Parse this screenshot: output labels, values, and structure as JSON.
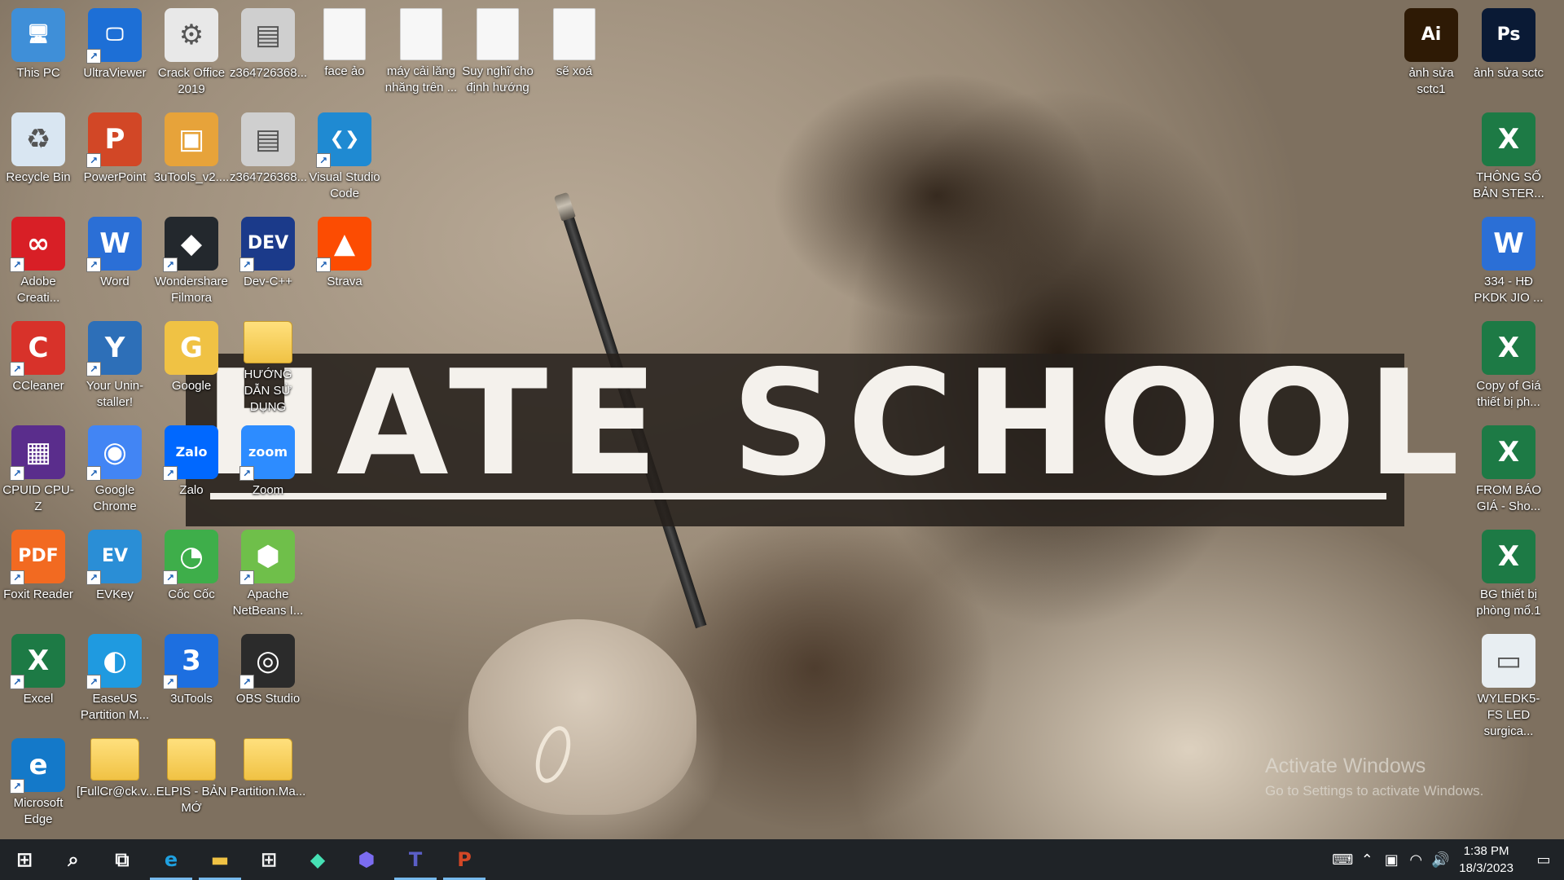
{
  "desktop": {
    "icons": [
      {
        "label": "This PC",
        "icon": "this-pc-icon",
        "color": "#3f8fd8",
        "glyph": "🖥"
      },
      {
        "label": "UltraViewer",
        "icon": "ultraviewer-icon",
        "color": "#1d6fd6",
        "glyph": "🖵"
      },
      {
        "label": "Crack Office 2019",
        "icon": "gear-file-icon",
        "color": "#e8e8e8",
        "glyph": "⚙"
      },
      {
        "label": "z364726368...",
        "icon": "image-file-icon",
        "color": "#cfcfcf",
        "glyph": "▤"
      },
      {
        "label": "face ảo",
        "icon": "blank-file-icon",
        "color": "#f7f7f7",
        "glyph": ""
      },
      {
        "label": "máy cải lăng nhăng trên ...",
        "icon": "blank-file-icon",
        "color": "#f7f7f7",
        "glyph": ""
      },
      {
        "label": "Suy nghĩ cho định hướng",
        "icon": "blank-file-icon",
        "color": "#f7f7f7",
        "glyph": ""
      },
      {
        "label": "sẽ xoá",
        "icon": "blank-file-icon",
        "color": "#f7f7f7",
        "glyph": ""
      },
      {
        "label": "Recycle Bin",
        "icon": "recycle-bin-icon",
        "color": "#d9e6f2",
        "glyph": "♻"
      },
      {
        "label": "PowerPoint",
        "icon": "powerpoint-icon",
        "color": "#d24726",
        "glyph": "P"
      },
      {
        "label": "3uTools_v2....",
        "icon": "3utools-installer-icon",
        "color": "#e7a33a",
        "glyph": "▣"
      },
      {
        "label": "z364726368...",
        "icon": "image-file-icon",
        "color": "#cfcfcf",
        "glyph": "▤"
      },
      {
        "label": "Visual Studio Code",
        "icon": "vscode-icon",
        "color": "#1f8ad2",
        "glyph": "❮❯"
      },
      {
        "label": "Adobe Creati...",
        "icon": "adobe-cc-icon",
        "color": "#d81f26",
        "glyph": "∞"
      },
      {
        "label": "Word",
        "icon": "word-icon",
        "color": "#2b6fd6",
        "glyph": "W"
      },
      {
        "label": "Wondershare Filmora",
        "icon": "filmora-icon",
        "color": "#23282d",
        "glyph": "◆"
      },
      {
        "label": "Dev-C++",
        "icon": "devcpp-icon",
        "color": "#1b3a8a",
        "glyph": "DEV"
      },
      {
        "label": "Strava",
        "icon": "strava-icon",
        "color": "#fc4c02",
        "glyph": "▲"
      },
      {
        "label": "CCleaner",
        "icon": "ccleaner-icon",
        "color": "#d8322a",
        "glyph": "C"
      },
      {
        "label": "Your Unin-staller!",
        "icon": "uninstaller-icon",
        "color": "#2d6fb8",
        "glyph": "Y"
      },
      {
        "label": "Google",
        "icon": "google-folder-icon",
        "color": "#f0c244",
        "glyph": "G"
      },
      {
        "label": "HƯỚNG DẪN SỬ DỤNG",
        "icon": "folder-icon",
        "color": "#f0c244",
        "glyph": ""
      },
      {
        "label": "CPUID CPU-Z",
        "icon": "cpuz-icon",
        "color": "#5a2d8c",
        "glyph": "▦"
      },
      {
        "label": "Google Chrome",
        "icon": "chrome-icon",
        "color": "#4285f4",
        "glyph": "◉"
      },
      {
        "label": "Zalo",
        "icon": "zalo-icon",
        "color": "#0068ff",
        "glyph": "Zalo"
      },
      {
        "label": "Zoom",
        "icon": "zoom-icon",
        "color": "#2d8cff",
        "glyph": "zoom"
      },
      {
        "label": "Foxit Reader",
        "icon": "foxit-reader-icon",
        "color": "#f26a21",
        "glyph": "PDF"
      },
      {
        "label": "EVKey",
        "icon": "evkey-icon",
        "color": "#2a8ed6",
        "glyph": "EV"
      },
      {
        "label": "Cốc Cốc",
        "icon": "coccoc-icon",
        "color": "#3eae4a",
        "glyph": "◔"
      },
      {
        "label": "Apache NetBeans I...",
        "icon": "netbeans-icon",
        "color": "#6fbf4a",
        "glyph": "⬢"
      },
      {
        "label": "Excel",
        "icon": "excel-icon",
        "color": "#1d7a45",
        "glyph": "X"
      },
      {
        "label": "EaseUS Partition M...",
        "icon": "easeus-icon",
        "color": "#1f9ae0",
        "glyph": "◐"
      },
      {
        "label": "3uTools",
        "icon": "3utools-icon",
        "color": "#1d6fe0",
        "glyph": "3"
      },
      {
        "label": "OBS Studio",
        "icon": "obs-icon",
        "color": "#2b2b2b",
        "glyph": "◎"
      },
      {
        "label": "Microsoft Edge",
        "icon": "edge-icon",
        "color": "#1479c9",
        "glyph": "e"
      },
      {
        "label": "[FullCr@ck.v...",
        "icon": "folder-icon",
        "color": "#f0c244",
        "glyph": ""
      },
      {
        "label": "ELPIS - BẢN MỚ",
        "icon": "folder-icon",
        "color": "#f0c244",
        "glyph": ""
      },
      {
        "label": "Partition.Ma...",
        "icon": "folder-icon",
        "color": "#f0c244",
        "glyph": ""
      },
      {
        "label": "ảnh sửa sctc1",
        "icon": "illustrator-file-icon",
        "color": "#2e1a05",
        "glyph": "Ai"
      },
      {
        "label": "ảnh sửa sctc",
        "icon": "photoshop-file-icon",
        "color": "#0a1a35",
        "glyph": "Ps"
      },
      {
        "label": "THÔNG SỐ BẢN STER...",
        "icon": "excel-file-icon",
        "color": "#1d7a45",
        "glyph": "X"
      },
      {
        "label": "334 - HĐ PKDK JIO ...",
        "icon": "word-file-icon",
        "color": "#2b6fd6",
        "glyph": "W"
      },
      {
        "label": "Copy of Giá thiết bị ph...",
        "icon": "excel-file-icon",
        "color": "#1d7a45",
        "glyph": "X"
      },
      {
        "label": "FROM BÁO GIÁ - Sho...",
        "icon": "excel-file-icon",
        "color": "#1d7a45",
        "glyph": "X"
      },
      {
        "label": "BG thiết bị phòng mổ.1",
        "icon": "excel-file-icon",
        "color": "#1d7a45",
        "glyph": "X"
      },
      {
        "label": "WYLEDK5-FS LED surgica...",
        "icon": "image-file-icon",
        "color": "#e8eef2",
        "glyph": "▭"
      }
    ]
  },
  "wallpaper": {
    "banner_text": "HATE SCHOOL"
  },
  "watermark": {
    "title": "Activate Windows",
    "subtitle": "Go to Settings to activate Windows."
  },
  "taskbar": {
    "items": [
      {
        "name": "start-button",
        "icon": "windows-start-icon",
        "glyph": "⊞",
        "color": "#ffffff",
        "active": false
      },
      {
        "name": "search-button",
        "icon": "search-icon",
        "glyph": "⌕",
        "color": "#ffffff",
        "active": false
      },
      {
        "name": "task-view-button",
        "icon": "task-view-icon",
        "glyph": "⧉",
        "color": "#ffffff",
        "active": false
      },
      {
        "name": "taskbar-edge",
        "icon": "edge-icon",
        "glyph": "e",
        "color": "#1fa0e0",
        "active": true
      },
      {
        "name": "taskbar-file-explorer",
        "icon": "folder-icon",
        "glyph": "▬",
        "color": "#f0c244",
        "active": true
      },
      {
        "name": "taskbar-store",
        "icon": "store-icon",
        "glyph": "⊞",
        "color": "#f2f2f2",
        "active": false
      },
      {
        "name": "taskbar-filmora",
        "icon": "filmora-icon",
        "glyph": "◆",
        "color": "#46e0b4",
        "active": false
      },
      {
        "name": "taskbar-app",
        "icon": "hexagon-app-icon",
        "glyph": "⬢",
        "color": "#7b6cf0",
        "active": false
      },
      {
        "name": "taskbar-teams",
        "icon": "teams-icon",
        "glyph": "T",
        "color": "#5b5fc7",
        "active": true
      },
      {
        "name": "taskbar-powerpoint",
        "icon": "powerpoint-icon",
        "glyph": "P",
        "color": "#d24726",
        "active": true
      }
    ],
    "tray": {
      "clock_time": "1:38 PM",
      "clock_date": "18/3/2023"
    }
  }
}
